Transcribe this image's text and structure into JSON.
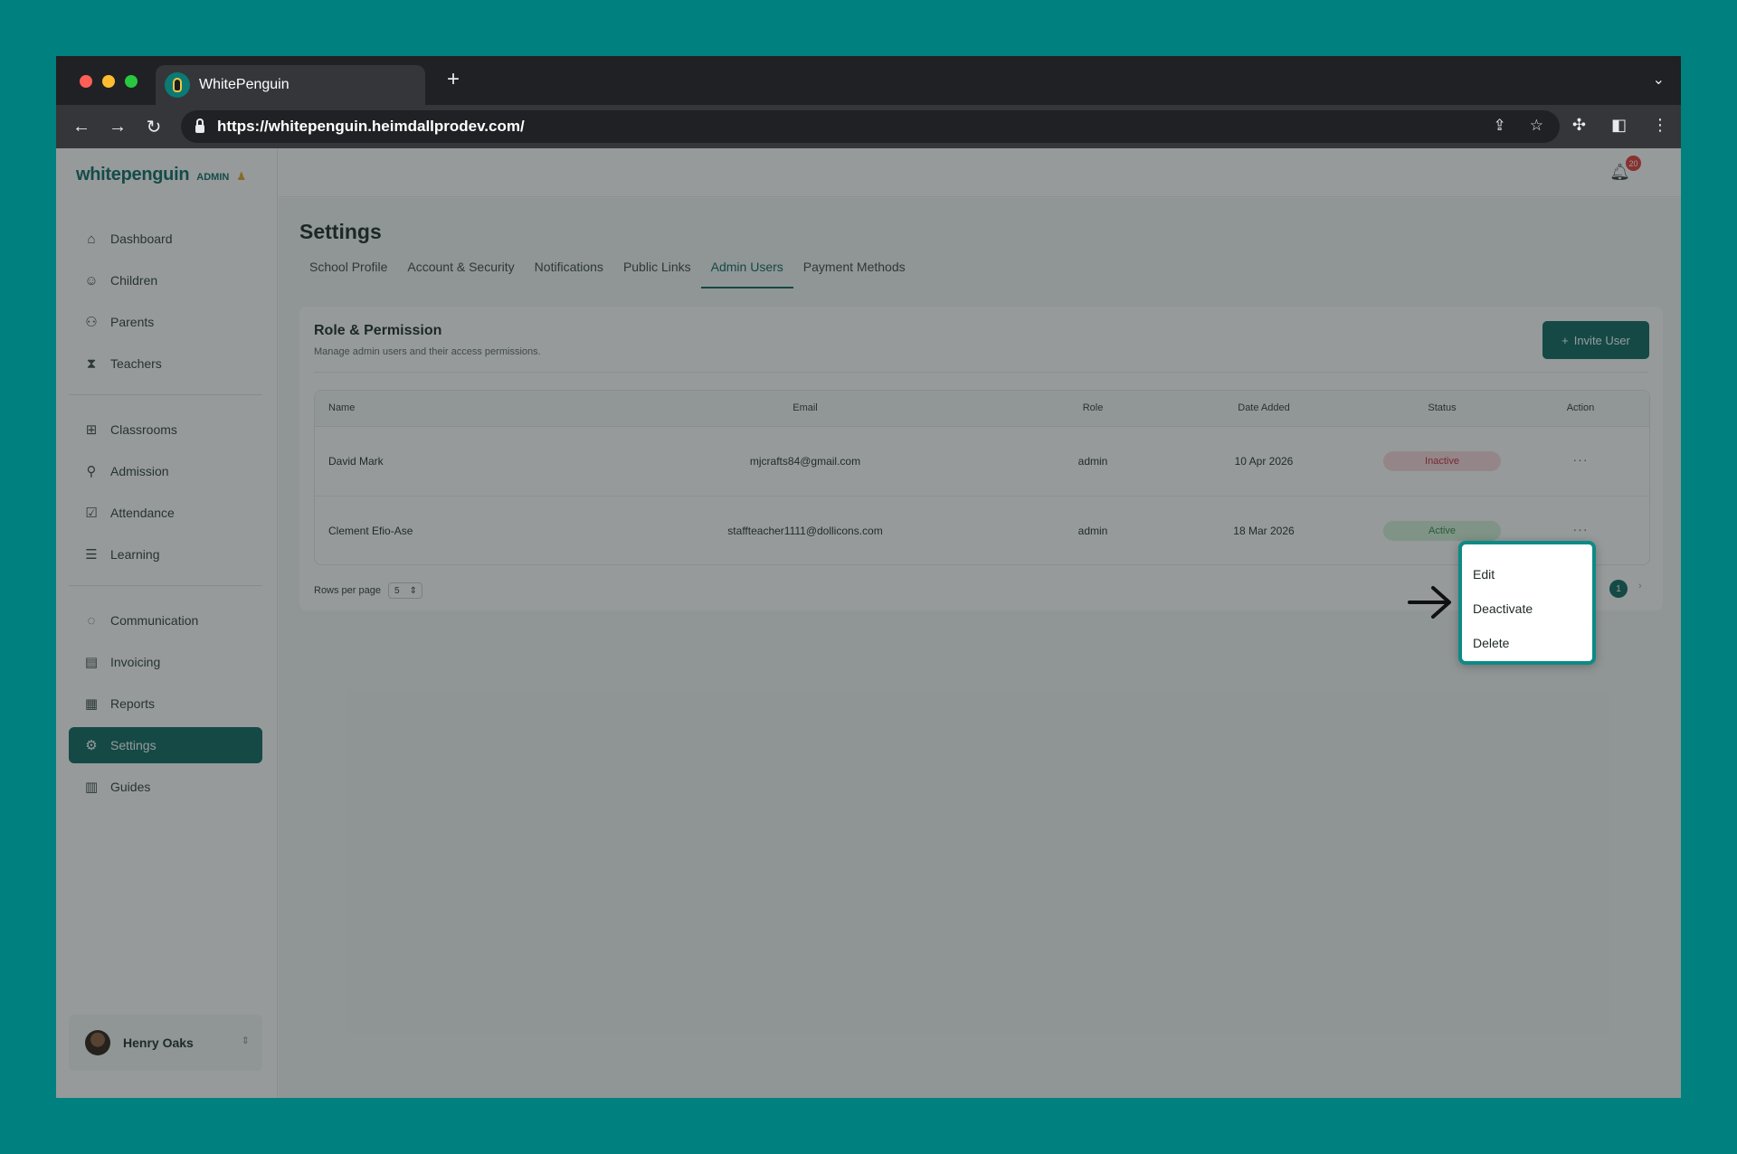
{
  "browser": {
    "tab_title": "WhitePenguin",
    "new_tab_symbol": "+",
    "url": "https://whitepenguin.heimdallprodev.com/"
  },
  "brand": {
    "logo_text": "whitepenguin",
    "tag": "ADMIN"
  },
  "sidebar": {
    "groups": [
      [
        {
          "label": "Dashboard",
          "icon": "home-icon"
        },
        {
          "label": "Children",
          "icon": "child-icon"
        },
        {
          "label": "Parents",
          "icon": "users-icon"
        },
        {
          "label": "Teachers",
          "icon": "teacher-icon"
        }
      ],
      [
        {
          "label": "Classrooms",
          "icon": "grid-icon"
        },
        {
          "label": "Admission",
          "icon": "user-plus-icon"
        },
        {
          "label": "Attendance",
          "icon": "check-square-icon"
        },
        {
          "label": "Learning",
          "icon": "book-list-icon"
        }
      ],
      [
        {
          "label": "Communication",
          "icon": "chat-icon"
        },
        {
          "label": "Invoicing",
          "icon": "receipt-icon"
        },
        {
          "label": "Reports",
          "icon": "chart-icon"
        },
        {
          "label": "Settings",
          "icon": "gear-icon",
          "active": true
        },
        {
          "label": "Guides",
          "icon": "open-book-icon"
        }
      ]
    ],
    "user": {
      "name": "Henry Oaks"
    }
  },
  "topbar": {
    "notification_count": "20"
  },
  "page": {
    "title": "Settings",
    "tabs": [
      {
        "label": "School Profile"
      },
      {
        "label": "Account & Security"
      },
      {
        "label": "Notifications"
      },
      {
        "label": "Public Links"
      },
      {
        "label": "Admin Users",
        "active": true
      },
      {
        "label": "Payment Methods"
      }
    ]
  },
  "card": {
    "title": "Role & Permission",
    "subtitle": "Manage admin users and their access permissions.",
    "invite_label": "Invite User",
    "invite_symbol": "+"
  },
  "table": {
    "headers": {
      "name": "Name",
      "email": "Email",
      "role": "Role",
      "date": "Date Added",
      "status": "Status",
      "action": "Action"
    },
    "rows": [
      {
        "name": "David Mark",
        "email": "mjcrafts84@gmail.com",
        "role": "admin",
        "date": "10 Apr 2026",
        "status": "Inactive",
        "action": "···"
      },
      {
        "name": "Clement Efio-Ase",
        "email": "staffteacher1111@dollicons.com",
        "role": "admin",
        "date": "18 Mar 2026",
        "status": "Active",
        "action": "···"
      }
    ]
  },
  "pagination": {
    "rows_label": "Rows per page",
    "rows_value": "5",
    "current_page": "1"
  },
  "action_menu": {
    "items": [
      {
        "label": "Edit"
      },
      {
        "label": "Deactivate"
      },
      {
        "label": "Delete"
      }
    ]
  },
  "colors": {
    "brand": "#0b6660",
    "backdrop": "#00807f",
    "inactive": "#c2293e",
    "active": "#2e8b48",
    "menu_outline": "#0d8a86"
  }
}
